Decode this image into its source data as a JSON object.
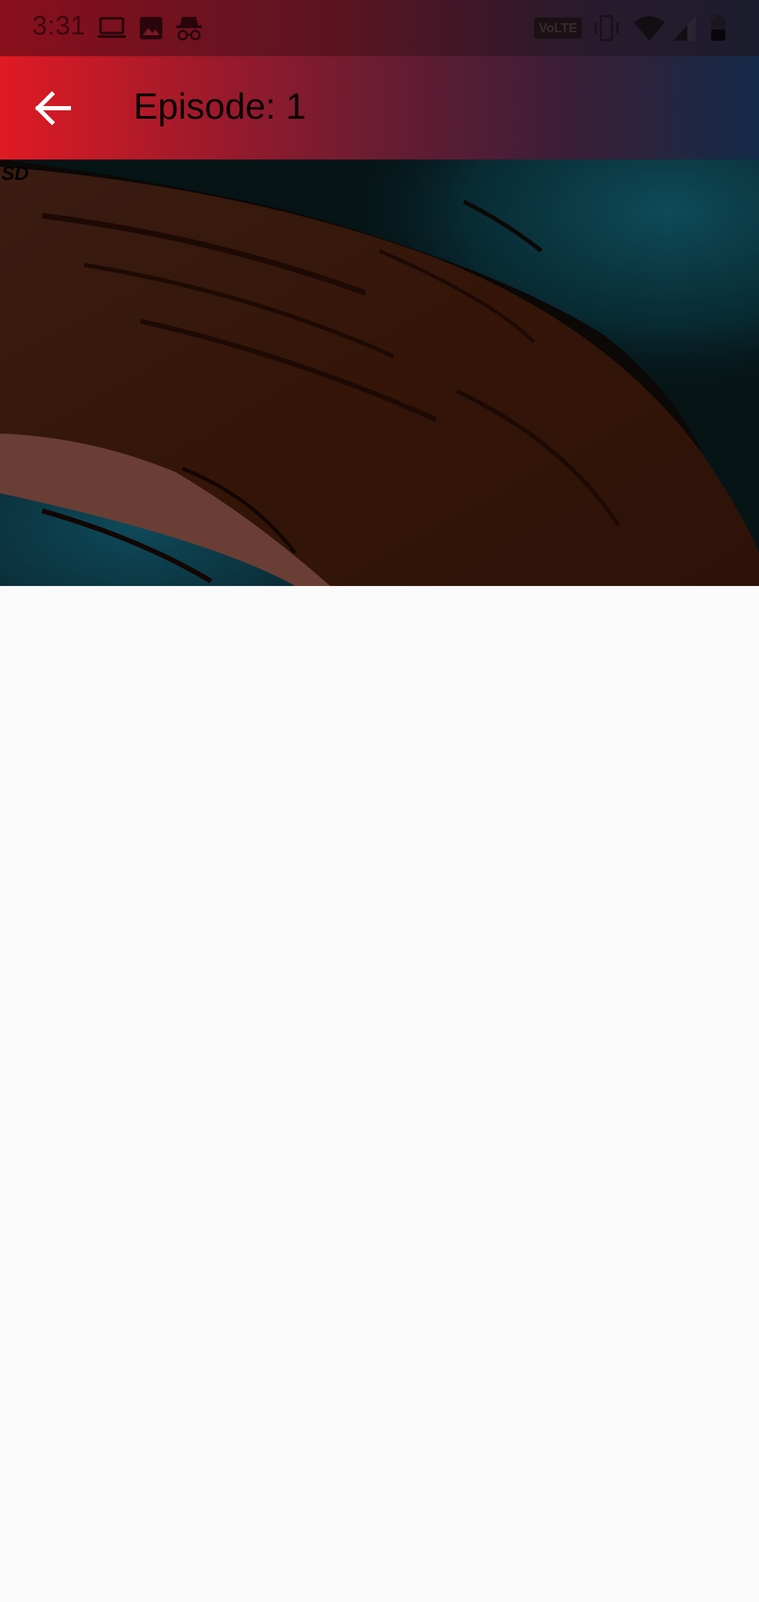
{
  "status_bar": {
    "time": "3:31",
    "left_icons": [
      "laptop-icon",
      "image-icon",
      "incognito-icon"
    ],
    "volte_label": "VoLTE",
    "right_icons": [
      "vibrate-icon",
      "wifi-icon",
      "signal-icon",
      "battery-icon"
    ]
  },
  "app_bar": {
    "back_icon": "arrow-back-icon",
    "title": "Episode: 1"
  },
  "video": {
    "quality_label": "SD"
  },
  "colors": {
    "app_bar_start": "#e01a24",
    "app_bar_end": "#132a48",
    "background": "#fafafa"
  }
}
